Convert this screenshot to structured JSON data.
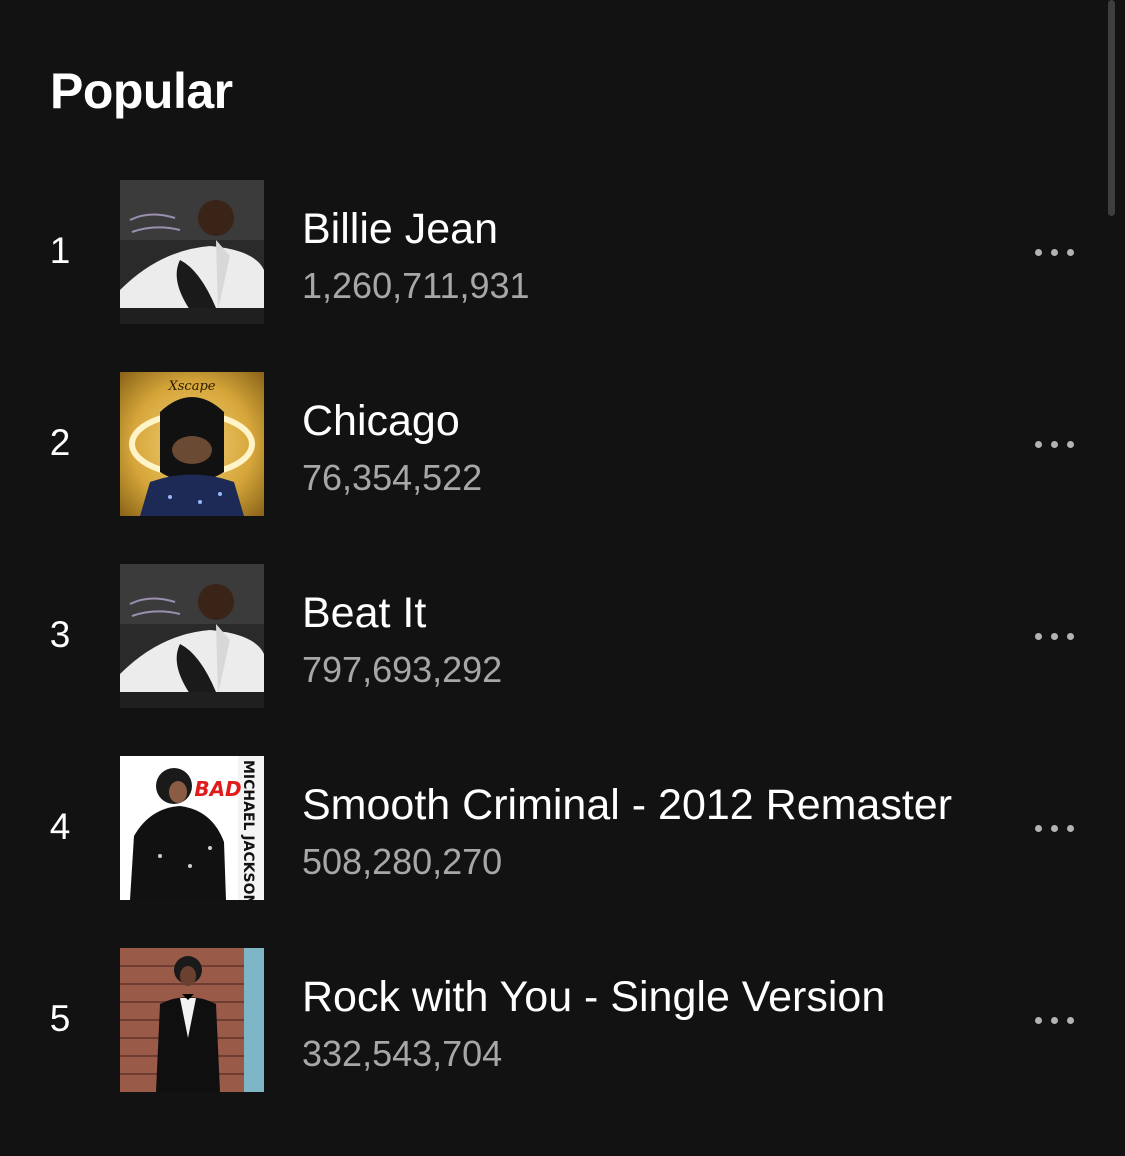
{
  "section": {
    "title": "Popular"
  },
  "tracks": [
    {
      "rank": "1",
      "title": "Billie Jean",
      "plays": "1,260,711,931",
      "cover": "thriller-album-cover"
    },
    {
      "rank": "2",
      "title": "Chicago",
      "plays": "76,354,522",
      "cover": "xscape-album-cover",
      "cover_text": "Xscape"
    },
    {
      "rank": "3",
      "title": "Beat It",
      "plays": "797,693,292",
      "cover": "thriller-album-cover"
    },
    {
      "rank": "4",
      "title": "Smooth Criminal - 2012 Remaster",
      "plays": "508,280,270",
      "cover": "bad-album-cover",
      "cover_text": "BAD",
      "cover_side_text": "MICHAEL JACKSON"
    },
    {
      "rank": "5",
      "title": "Rock with You - Single Version",
      "plays": "332,543,704",
      "cover": "off-the-wall-album-cover"
    }
  ],
  "icons": {
    "more": "more-options-icon"
  },
  "colors": {
    "background": "#121212",
    "primary_text": "#ffffff",
    "secondary_text": "#a7a7a7",
    "icon": "#b3b3b3"
  }
}
